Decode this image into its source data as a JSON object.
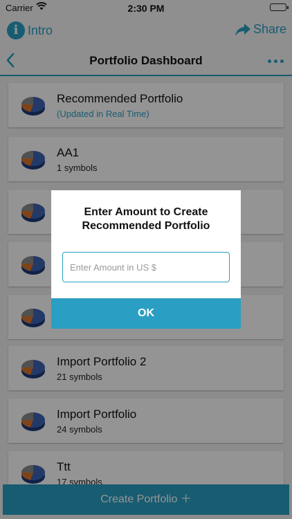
{
  "status_bar": {
    "carrier": "Carrier",
    "time": "2:30 PM"
  },
  "top_bar": {
    "intro_label": "Intro",
    "share_label": "Share"
  },
  "nav": {
    "title": "Portfolio Dashboard"
  },
  "portfolios": [
    {
      "name": "Recommended Portfolio",
      "subtitle": "(Updated in Real Time)"
    },
    {
      "name": "AA1",
      "subtitle": "1 symbols"
    },
    {
      "name": "",
      "subtitle": ""
    },
    {
      "name": "",
      "subtitle": ""
    },
    {
      "name": "",
      "subtitle": ""
    },
    {
      "name": "Import Portfolio 2",
      "subtitle": "21 symbols"
    },
    {
      "name": "Import Portfolio",
      "subtitle": "24 symbols"
    },
    {
      "name": "Ttt",
      "subtitle": "17 symbols"
    }
  ],
  "create_button": {
    "label": "Create Portfolio ＋"
  },
  "dialog": {
    "title_line1": "Enter Amount to Create",
    "title_line2": "Recommended Portfolio",
    "input_placeholder": "Enter Amount in US $",
    "input_value": "",
    "ok_label": "OK"
  },
  "colors": {
    "accent": "#2a9fc3",
    "overlay": "rgba(0,0,0,0.42)",
    "pie_blue": "#3d64b3",
    "pie_orange": "#d9762b",
    "pie_gray": "#8c8c8c"
  }
}
